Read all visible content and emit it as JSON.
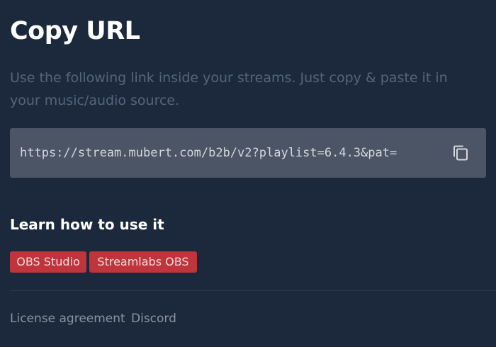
{
  "title": "Copy URL",
  "description": "Use the following link inside your streams. Just copy & paste it in your music/audio source.",
  "url_box": {
    "url": "https://stream.mubert.com/b2b/v2?playlist=6.4.3&pat=",
    "copy_icon": "copy-icon"
  },
  "learn": {
    "heading": "Learn how to use it",
    "tags": [
      "OBS Studio",
      "Streamlabs OBS"
    ]
  },
  "footer": {
    "links": [
      "License agreement",
      "Discord"
    ]
  },
  "colors": {
    "background": "#1c293d",
    "url_box": "#4b5566",
    "tag": "#c0353c",
    "muted_text": "#56647b"
  }
}
